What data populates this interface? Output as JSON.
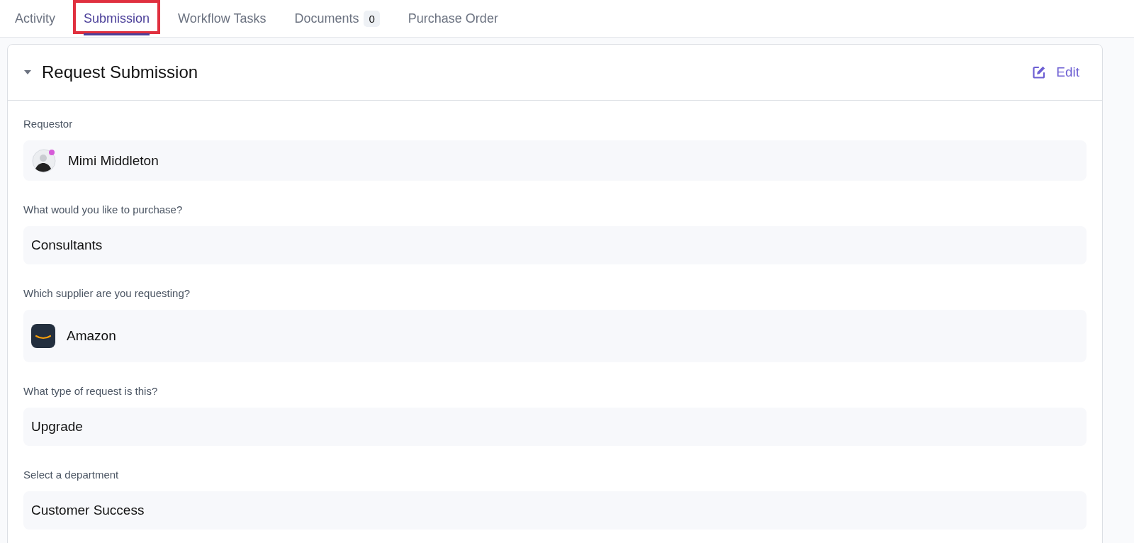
{
  "tabs": [
    {
      "label": "Activity",
      "selected": false,
      "highlighted": false
    },
    {
      "label": "Submission",
      "selected": true,
      "highlighted": true
    },
    {
      "label": "Workflow Tasks",
      "selected": false,
      "highlighted": false
    },
    {
      "label": "Documents",
      "selected": false,
      "highlighted": false,
      "count": "0"
    },
    {
      "label": "Purchase Order",
      "selected": false,
      "highlighted": false
    }
  ],
  "section": {
    "title": "Request Submission",
    "expanded": true,
    "edit_label": "Edit"
  },
  "fields": [
    {
      "label": "Requestor",
      "kind": "person",
      "value": "Mimi Middleton"
    },
    {
      "label": "What would you like to purchase?",
      "kind": "text",
      "value": "Consultants"
    },
    {
      "label": "Which supplier are you requesting?",
      "kind": "supplier",
      "value": "Amazon"
    },
    {
      "label": "What type of request is this?",
      "kind": "text",
      "value": "Upgrade"
    },
    {
      "label": "Select a department",
      "kind": "text",
      "value": "Customer Success"
    }
  ]
}
